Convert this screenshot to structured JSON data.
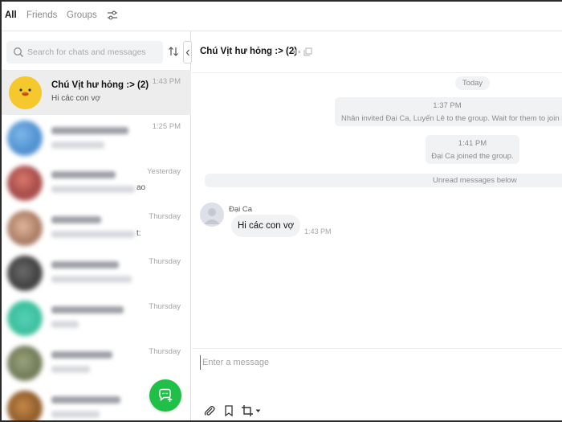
{
  "tabs": [
    {
      "label": "All",
      "active": true
    },
    {
      "label": "Friends",
      "active": false
    },
    {
      "label": "Groups",
      "active": false
    }
  ],
  "search": {
    "placeholder": "Search for chats and messages"
  },
  "chats": [
    {
      "name": "Chú Vịt hư hỏng :> (2)",
      "preview": "Hi các con vợ",
      "time": "1:43 PM",
      "selected": true
    },
    {
      "time": "1:25 PM"
    },
    {
      "time": "Yesterday",
      "fragment": "ao"
    },
    {
      "time": "Thursday",
      "fragment": "t:"
    },
    {
      "time": "Thursday"
    },
    {
      "time": "Thursday"
    },
    {
      "time": "Thursday"
    },
    {
      "time": ""
    }
  ],
  "header": {
    "title": "Chú Vịt hư hỏng :> (2)"
  },
  "messages": {
    "date_separator": "Today",
    "system": [
      {
        "time": "1:37 PM",
        "text": "Nhân invited Đại Ca, Luyến Lê to the group. Wait for them to join b"
      },
      {
        "time": "1:41 PM",
        "text": "Đại Ca joined the group."
      }
    ],
    "unread_label": "Unread messages below",
    "incoming": {
      "sender": "Đại Ca",
      "text": "Hi các con vợ",
      "time": "1:43 PM"
    }
  },
  "composer": {
    "placeholder": "Enter a message"
  },
  "colors": {
    "accent": "#1fbf48",
    "selected_row": "#ededee",
    "pill_bg": "#f1f2f4"
  }
}
